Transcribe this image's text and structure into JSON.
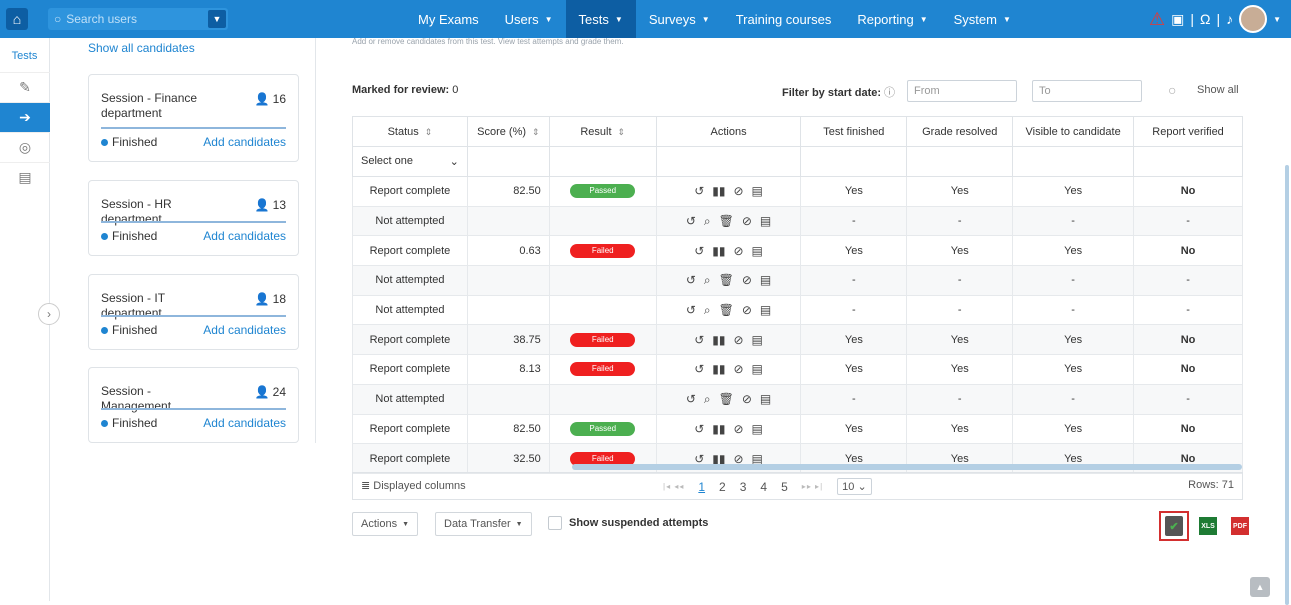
{
  "search": {
    "placeholder": "Search users"
  },
  "nav": {
    "items": [
      {
        "label": "My Exams",
        "caret": ""
      },
      {
        "label": "Users",
        "caret": "▼"
      },
      {
        "label": "Tests",
        "caret": "▼"
      },
      {
        "label": "Surveys",
        "caret": "▼"
      },
      {
        "label": "Training courses",
        "caret": ""
      },
      {
        "label": "Reporting",
        "caret": "▼"
      },
      {
        "label": "System",
        "caret": "▼"
      }
    ],
    "active": "Tests"
  },
  "sidebar": {
    "tests_label": "Tests"
  },
  "left": {
    "show_all": "Show all candidates",
    "sessions": [
      {
        "title": "Session - Finance department",
        "count": "16",
        "status": "Finished",
        "add": "Add candidates"
      },
      {
        "title": "Session - HR department",
        "count": "13",
        "status": "Finished",
        "add": "Add candidates"
      },
      {
        "title": "Session - IT department",
        "count": "18",
        "status": "Finished",
        "add": "Add candidates"
      },
      {
        "title": "Session - Management",
        "count": "24",
        "status": "Finished",
        "add": "Add candidates"
      }
    ]
  },
  "main": {
    "subtitle": "Add or remove candidates from this test. View test attempts and grade them.",
    "marked_label": "Marked for review:",
    "marked_value": "0",
    "filter_label": "Filter by start date:",
    "from_placeholder": "From",
    "to_placeholder": "To",
    "show_all": "Show all"
  },
  "table": {
    "columns": [
      "Status",
      "Score (%)",
      "Result",
      "Actions",
      "Test finished",
      "Grade resolved",
      "Visible to candidate",
      "Report verified"
    ],
    "status_filter": "Select one",
    "rows": [
      {
        "status": "Report complete",
        "score": "82.50",
        "result": "Passed",
        "finished": "Yes",
        "graded": "Yes",
        "visible": "Yes",
        "verified": "No"
      },
      {
        "status": "Not attempted",
        "score": "",
        "result": "",
        "finished": "-",
        "graded": "-",
        "visible": "-",
        "verified": "-"
      },
      {
        "status": "Report complete",
        "score": "0.63",
        "result": "Failed",
        "finished": "Yes",
        "graded": "Yes",
        "visible": "Yes",
        "verified": "No"
      },
      {
        "status": "Not attempted",
        "score": "",
        "result": "",
        "finished": "-",
        "graded": "-",
        "visible": "-",
        "verified": "-"
      },
      {
        "status": "Not attempted",
        "score": "",
        "result": "",
        "finished": "-",
        "graded": "-",
        "visible": "-",
        "verified": "-"
      },
      {
        "status": "Report complete",
        "score": "38.75",
        "result": "Failed",
        "finished": "Yes",
        "graded": "Yes",
        "visible": "Yes",
        "verified": "No"
      },
      {
        "status": "Report complete",
        "score": "8.13",
        "result": "Failed",
        "finished": "Yes",
        "graded": "Yes",
        "visible": "Yes",
        "verified": "No"
      },
      {
        "status": "Not attempted",
        "score": "",
        "result": "",
        "finished": "-",
        "graded": "-",
        "visible": "-",
        "verified": "-"
      },
      {
        "status": "Report complete",
        "score": "82.50",
        "result": "Passed",
        "finished": "Yes",
        "graded": "Yes",
        "visible": "Yes",
        "verified": "No"
      },
      {
        "status": "Report complete",
        "score": "32.50",
        "result": "Failed",
        "finished": "Yes",
        "graded": "Yes",
        "visible": "Yes",
        "verified": "No"
      }
    ]
  },
  "footer": {
    "displayed_columns": "Displayed columns",
    "pages": [
      "1",
      "2",
      "3",
      "4",
      "5"
    ],
    "page_size": "10",
    "rows_label": "Rows: 71"
  },
  "bottom": {
    "actions": "Actions",
    "data_transfer": "Data Transfer",
    "suspended": "Show suspended attempts"
  },
  "exports": {
    "xls": "XLS",
    "pdf": "PDF"
  }
}
